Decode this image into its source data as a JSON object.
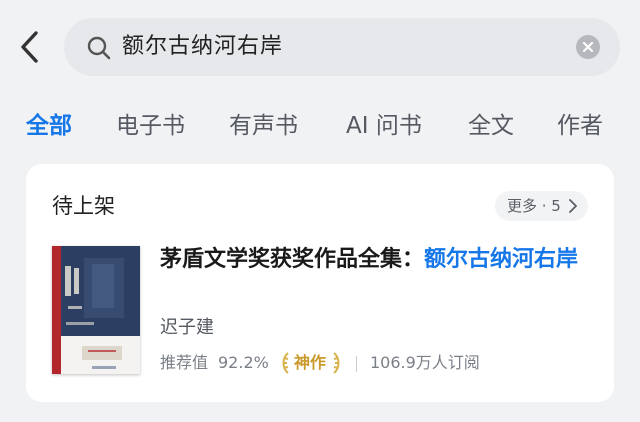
{
  "search": {
    "query": "额尔古纳河右岸"
  },
  "tabs": [
    {
      "label": "全部",
      "active": true
    },
    {
      "label": "电子书"
    },
    {
      "label": "有声书"
    },
    {
      "label": "AI 问书"
    },
    {
      "label": "全文"
    },
    {
      "label": "作者"
    }
  ],
  "section": {
    "title": "待上架",
    "more_label": "更多 · 5"
  },
  "book": {
    "title_prefix": "茅盾文学奖获奖作品全集：",
    "title_highlight": "额尔古纳河右岸",
    "author": "迟子建",
    "rating_label": "推荐值",
    "rating_value": "92.2%",
    "badge": "神作",
    "readers": "106.9万人订阅"
  },
  "icons": [
    "back-arrow-icon",
    "search-icon",
    "clear-icon",
    "chevron-right-icon",
    "laurel-icon"
  ],
  "colors": {
    "accent": "#1677e8",
    "badge": "#c99a2a",
    "cover_red": "#b3262b",
    "cover_blue": "#2c3f63"
  }
}
